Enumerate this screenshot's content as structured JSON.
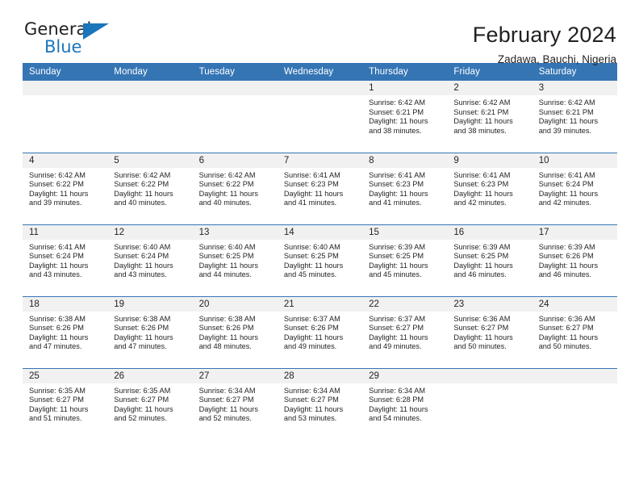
{
  "brand": {
    "name_part1": "General",
    "name_part2": "Blue",
    "triangle_icon": "triangle-icon",
    "accent_color": "#1b75bb"
  },
  "header": {
    "title": "February 2024",
    "subtitle": "Zadawa, Bauchi, Nigeria",
    "header_bg_color": "#3575b4",
    "daynum_bg_color": "#f1f1f1"
  },
  "weekday_headers": [
    "Sunday",
    "Monday",
    "Tuesday",
    "Wednesday",
    "Thursday",
    "Friday",
    "Saturday"
  ],
  "labels": {
    "sunrise": "Sunrise:",
    "sunset": "Sunset:",
    "daylight": "Daylight:"
  },
  "weeks": [
    [
      {
        "day": "",
        "sunrise": "",
        "sunset": "",
        "daylight_line1": "",
        "daylight_line2": ""
      },
      {
        "day": "",
        "sunrise": "",
        "sunset": "",
        "daylight_line1": "",
        "daylight_line2": ""
      },
      {
        "day": "",
        "sunrise": "",
        "sunset": "",
        "daylight_line1": "",
        "daylight_line2": ""
      },
      {
        "day": "",
        "sunrise": "",
        "sunset": "",
        "daylight_line1": "",
        "daylight_line2": ""
      },
      {
        "day": "1",
        "sunrise": "Sunrise: 6:42 AM",
        "sunset": "Sunset: 6:21 PM",
        "daylight_line1": "Daylight: 11 hours",
        "daylight_line2": "and 38 minutes."
      },
      {
        "day": "2",
        "sunrise": "Sunrise: 6:42 AM",
        "sunset": "Sunset: 6:21 PM",
        "daylight_line1": "Daylight: 11 hours",
        "daylight_line2": "and 38 minutes."
      },
      {
        "day": "3",
        "sunrise": "Sunrise: 6:42 AM",
        "sunset": "Sunset: 6:21 PM",
        "daylight_line1": "Daylight: 11 hours",
        "daylight_line2": "and 39 minutes."
      }
    ],
    [
      {
        "day": "4",
        "sunrise": "Sunrise: 6:42 AM",
        "sunset": "Sunset: 6:22 PM",
        "daylight_line1": "Daylight: 11 hours",
        "daylight_line2": "and 39 minutes."
      },
      {
        "day": "5",
        "sunrise": "Sunrise: 6:42 AM",
        "sunset": "Sunset: 6:22 PM",
        "daylight_line1": "Daylight: 11 hours",
        "daylight_line2": "and 40 minutes."
      },
      {
        "day": "6",
        "sunrise": "Sunrise: 6:42 AM",
        "sunset": "Sunset: 6:22 PM",
        "daylight_line1": "Daylight: 11 hours",
        "daylight_line2": "and 40 minutes."
      },
      {
        "day": "7",
        "sunrise": "Sunrise: 6:41 AM",
        "sunset": "Sunset: 6:23 PM",
        "daylight_line1": "Daylight: 11 hours",
        "daylight_line2": "and 41 minutes."
      },
      {
        "day": "8",
        "sunrise": "Sunrise: 6:41 AM",
        "sunset": "Sunset: 6:23 PM",
        "daylight_line1": "Daylight: 11 hours",
        "daylight_line2": "and 41 minutes."
      },
      {
        "day": "9",
        "sunrise": "Sunrise: 6:41 AM",
        "sunset": "Sunset: 6:23 PM",
        "daylight_line1": "Daylight: 11 hours",
        "daylight_line2": "and 42 minutes."
      },
      {
        "day": "10",
        "sunrise": "Sunrise: 6:41 AM",
        "sunset": "Sunset: 6:24 PM",
        "daylight_line1": "Daylight: 11 hours",
        "daylight_line2": "and 42 minutes."
      }
    ],
    [
      {
        "day": "11",
        "sunrise": "Sunrise: 6:41 AM",
        "sunset": "Sunset: 6:24 PM",
        "daylight_line1": "Daylight: 11 hours",
        "daylight_line2": "and 43 minutes."
      },
      {
        "day": "12",
        "sunrise": "Sunrise: 6:40 AM",
        "sunset": "Sunset: 6:24 PM",
        "daylight_line1": "Daylight: 11 hours",
        "daylight_line2": "and 43 minutes."
      },
      {
        "day": "13",
        "sunrise": "Sunrise: 6:40 AM",
        "sunset": "Sunset: 6:25 PM",
        "daylight_line1": "Daylight: 11 hours",
        "daylight_line2": "and 44 minutes."
      },
      {
        "day": "14",
        "sunrise": "Sunrise: 6:40 AM",
        "sunset": "Sunset: 6:25 PM",
        "daylight_line1": "Daylight: 11 hours",
        "daylight_line2": "and 45 minutes."
      },
      {
        "day": "15",
        "sunrise": "Sunrise: 6:39 AM",
        "sunset": "Sunset: 6:25 PM",
        "daylight_line1": "Daylight: 11 hours",
        "daylight_line2": "and 45 minutes."
      },
      {
        "day": "16",
        "sunrise": "Sunrise: 6:39 AM",
        "sunset": "Sunset: 6:25 PM",
        "daylight_line1": "Daylight: 11 hours",
        "daylight_line2": "and 46 minutes."
      },
      {
        "day": "17",
        "sunrise": "Sunrise: 6:39 AM",
        "sunset": "Sunset: 6:26 PM",
        "daylight_line1": "Daylight: 11 hours",
        "daylight_line2": "and 46 minutes."
      }
    ],
    [
      {
        "day": "18",
        "sunrise": "Sunrise: 6:38 AM",
        "sunset": "Sunset: 6:26 PM",
        "daylight_line1": "Daylight: 11 hours",
        "daylight_line2": "and 47 minutes."
      },
      {
        "day": "19",
        "sunrise": "Sunrise: 6:38 AM",
        "sunset": "Sunset: 6:26 PM",
        "daylight_line1": "Daylight: 11 hours",
        "daylight_line2": "and 47 minutes."
      },
      {
        "day": "20",
        "sunrise": "Sunrise: 6:38 AM",
        "sunset": "Sunset: 6:26 PM",
        "daylight_line1": "Daylight: 11 hours",
        "daylight_line2": "and 48 minutes."
      },
      {
        "day": "21",
        "sunrise": "Sunrise: 6:37 AM",
        "sunset": "Sunset: 6:26 PM",
        "daylight_line1": "Daylight: 11 hours",
        "daylight_line2": "and 49 minutes."
      },
      {
        "day": "22",
        "sunrise": "Sunrise: 6:37 AM",
        "sunset": "Sunset: 6:27 PM",
        "daylight_line1": "Daylight: 11 hours",
        "daylight_line2": "and 49 minutes."
      },
      {
        "day": "23",
        "sunrise": "Sunrise: 6:36 AM",
        "sunset": "Sunset: 6:27 PM",
        "daylight_line1": "Daylight: 11 hours",
        "daylight_line2": "and 50 minutes."
      },
      {
        "day": "24",
        "sunrise": "Sunrise: 6:36 AM",
        "sunset": "Sunset: 6:27 PM",
        "daylight_line1": "Daylight: 11 hours",
        "daylight_line2": "and 50 minutes."
      }
    ],
    [
      {
        "day": "25",
        "sunrise": "Sunrise: 6:35 AM",
        "sunset": "Sunset: 6:27 PM",
        "daylight_line1": "Daylight: 11 hours",
        "daylight_line2": "and 51 minutes."
      },
      {
        "day": "26",
        "sunrise": "Sunrise: 6:35 AM",
        "sunset": "Sunset: 6:27 PM",
        "daylight_line1": "Daylight: 11 hours",
        "daylight_line2": "and 52 minutes."
      },
      {
        "day": "27",
        "sunrise": "Sunrise: 6:34 AM",
        "sunset": "Sunset: 6:27 PM",
        "daylight_line1": "Daylight: 11 hours",
        "daylight_line2": "and 52 minutes."
      },
      {
        "day": "28",
        "sunrise": "Sunrise: 6:34 AM",
        "sunset": "Sunset: 6:27 PM",
        "daylight_line1": "Daylight: 11 hours",
        "daylight_line2": "and 53 minutes."
      },
      {
        "day": "29",
        "sunrise": "Sunrise: 6:34 AM",
        "sunset": "Sunset: 6:28 PM",
        "daylight_line1": "Daylight: 11 hours",
        "daylight_line2": "and 54 minutes."
      },
      {
        "day": "",
        "sunrise": "",
        "sunset": "",
        "daylight_line1": "",
        "daylight_line2": ""
      },
      {
        "day": "",
        "sunrise": "",
        "sunset": "",
        "daylight_line1": "",
        "daylight_line2": ""
      }
    ]
  ]
}
